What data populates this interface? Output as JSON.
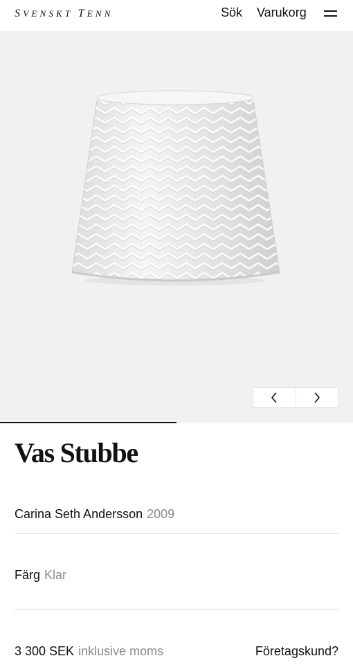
{
  "header": {
    "logo_first_initial": "S",
    "logo_first_rest": "VENSKT",
    "logo_second_initial": "T",
    "logo_second_rest": "ENN",
    "search_label": "Sök",
    "cart_label": "Varukorg",
    "menu_icon": "hamburger-menu-icon"
  },
  "gallery": {
    "image": "glass-vase-chevron-pattern",
    "prev_icon": "chevron-left-icon",
    "next_icon": "chevron-right-icon",
    "progress_fraction": 0.5
  },
  "product": {
    "title": "Vas Stubbe",
    "designer": "Carina Seth Andersson",
    "year": "2009",
    "color_label": "Färg",
    "color_value": "Klar",
    "price": "3 300 SEK",
    "price_note": "inklusive moms",
    "business_link": "Företagskund?"
  },
  "colors": {
    "gallery_background": "#f1f1f1",
    "text": "#111111",
    "muted_text": "#8a8a8a"
  }
}
